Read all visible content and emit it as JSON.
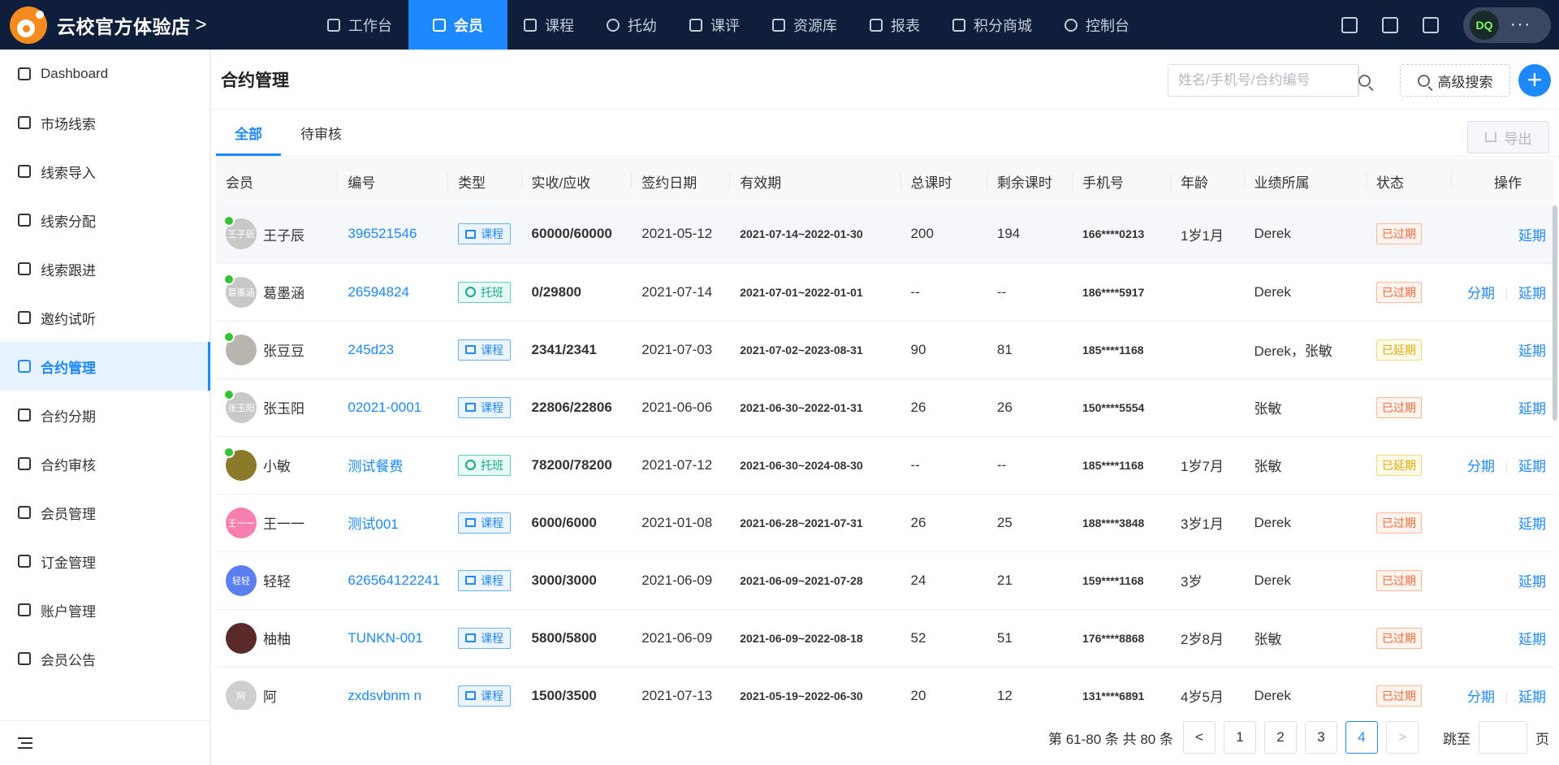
{
  "app": {
    "store_name": "云校官方体验店",
    "chevron": ">",
    "nav": [
      {
        "label": "工作台",
        "icon": "monitor-icon"
      },
      {
        "label": "会员",
        "icon": "user-icon",
        "active": true
      },
      {
        "label": "课程",
        "icon": "book-icon"
      },
      {
        "label": "托幼",
        "icon": "smile-icon"
      },
      {
        "label": "课评",
        "icon": "star-icon"
      },
      {
        "label": "资源库",
        "icon": "file-search-icon"
      },
      {
        "label": "报表",
        "icon": "chart-icon"
      },
      {
        "label": "积分商城",
        "icon": "shop-icon"
      },
      {
        "label": "控制台",
        "icon": "gear-icon"
      }
    ],
    "user_avatar_text": "DQ",
    "user_more": "···"
  },
  "sidebar": {
    "items": [
      {
        "label": "Dashboard",
        "icon": "dashboard-icon"
      },
      {
        "label": "市场线索",
        "icon": "clue-icon"
      },
      {
        "label": "线索导入",
        "icon": "import-icon"
      },
      {
        "label": "线索分配",
        "icon": "share-icon"
      },
      {
        "label": "线索跟进",
        "icon": "chat-icon"
      },
      {
        "label": "邀约试听",
        "icon": "invite-icon"
      },
      {
        "label": "合约管理",
        "icon": "contract-icon",
        "active": true
      },
      {
        "label": "合约分期",
        "icon": "installment-icon"
      },
      {
        "label": "合约审核",
        "icon": "audit-icon"
      },
      {
        "label": "会员管理",
        "icon": "members-icon"
      },
      {
        "label": "订金管理",
        "icon": "deposit-icon"
      },
      {
        "label": "账户管理",
        "icon": "account-icon"
      },
      {
        "label": "会员公告",
        "icon": "announce-icon"
      }
    ]
  },
  "header": {
    "title": "合约管理",
    "search_placeholder": "姓名/手机号/合约编号",
    "advanced_search": "高级搜索",
    "add": "+"
  },
  "tabs": [
    {
      "label": "全部",
      "active": true
    },
    {
      "label": "待审核"
    }
  ],
  "export_label": "导出",
  "table": {
    "columns": [
      "会员",
      "编号",
      "类型",
      "实收/应收",
      "签约日期",
      "有效期",
      "总课时",
      "剩余课时",
      "手机号",
      "年龄",
      "业绩所属",
      "状态",
      "操作"
    ],
    "rows": [
      {
        "name": "王子辰",
        "avatar_text": "王子辰",
        "avatar_color": "#c8c8c8",
        "wx": true,
        "code": "396521546",
        "type": "课程",
        "type_kind": "course",
        "amount": "60000/60000",
        "date": "2021-05-12",
        "period": "2021-07-14~2022-01-30",
        "total": "200",
        "remain": "194",
        "phone": "166****0213",
        "age": "1岁1月",
        "owner": "Derek",
        "status": "已过期",
        "status_kind": "expired",
        "ops": [
          "延期"
        ]
      },
      {
        "name": "葛墨涵",
        "avatar_text": "葛墨涵",
        "avatar_color": "#c8c8c8",
        "wx": true,
        "code": "26594824",
        "type": "托班",
        "type_kind": "care",
        "amount": "0/29800",
        "date": "2021-07-14",
        "period": "2021-07-01~2022-01-01",
        "total": "--",
        "remain": "--",
        "phone": "186****5917",
        "age": "",
        "owner": "Derek",
        "status": "已过期",
        "status_kind": "expired",
        "ops": [
          "分期",
          "延期"
        ]
      },
      {
        "name": "张豆豆",
        "avatar_text": "",
        "avatar_color": "#b9b4ae",
        "wx": true,
        "code": "245d23",
        "type": "课程",
        "type_kind": "course",
        "amount": "2341/2341",
        "date": "2021-07-03",
        "period": "2021-07-02~2023-08-31",
        "total": "90",
        "remain": "81",
        "phone": "185****1168",
        "age": "",
        "owner": "Derek，张敏",
        "status": "已延期",
        "status_kind": "extended",
        "ops": [
          "延期"
        ]
      },
      {
        "name": "张玉阳",
        "avatar_text": "张玉阳",
        "avatar_color": "#c8c8c8",
        "wx": true,
        "code": "02021-0001",
        "type": "课程",
        "type_kind": "course",
        "amount": "22806/22806",
        "date": "2021-06-06",
        "period": "2021-06-30~2022-01-31",
        "total": "26",
        "remain": "26",
        "phone": "150****5554",
        "age": "",
        "owner": "张敏",
        "status": "已过期",
        "status_kind": "expired",
        "ops": [
          "延期"
        ]
      },
      {
        "name": "小敏",
        "avatar_text": "",
        "avatar_color": "#8a7a2a",
        "wx": true,
        "code": "测试餐费",
        "type": "托班",
        "type_kind": "care",
        "amount": "78200/78200",
        "date": "2021-07-12",
        "period": "2021-06-30~2024-08-30",
        "total": "--",
        "remain": "--",
        "phone": "185****1168",
        "age": "1岁7月",
        "owner": "张敏",
        "status": "已延期",
        "status_kind": "extended",
        "ops": [
          "分期",
          "延期"
        ]
      },
      {
        "name": "王一一",
        "avatar_text": "王一一",
        "avatar_color": "#f77fb0",
        "wx": false,
        "code": "测试001",
        "type": "课程",
        "type_kind": "course",
        "amount": "6000/6000",
        "date": "2021-01-08",
        "period": "2021-06-28~2021-07-31",
        "total": "26",
        "remain": "25",
        "phone": "188****3848",
        "age": "3岁1月",
        "owner": "Derek",
        "status": "已过期",
        "status_kind": "expired",
        "ops": [
          "延期"
        ]
      },
      {
        "name": "轻轻",
        "avatar_text": "轻轻",
        "avatar_color": "#5b7ff0",
        "wx": false,
        "code": "626564122241",
        "type": "课程",
        "type_kind": "course",
        "amount": "3000/3000",
        "date": "2021-06-09",
        "period": "2021-06-09~2021-07-28",
        "total": "24",
        "remain": "21",
        "phone": "159****1168",
        "age": "3岁",
        "owner": "Derek",
        "status": "已过期",
        "status_kind": "expired",
        "ops": [
          "延期"
        ]
      },
      {
        "name": "柚柚",
        "avatar_text": "",
        "avatar_color": "#5a2a2a",
        "wx": false,
        "code": "TUNKN-001",
        "type": "课程",
        "type_kind": "course",
        "amount": "5800/5800",
        "date": "2021-06-09",
        "period": "2021-06-09~2022-08-18",
        "total": "52",
        "remain": "51",
        "phone": "176****8868",
        "age": "2岁8月",
        "owner": "张敏",
        "status": "已过期",
        "status_kind": "expired",
        "ops": [
          "延期"
        ]
      },
      {
        "name": "阿",
        "avatar_text": "阿",
        "avatar_color": "#cfcfcf",
        "wx": false,
        "code": "zxdsvbnm n",
        "type": "课程",
        "type_kind": "course",
        "amount": "1500/3500",
        "date": "2021-07-13",
        "period": "2021-05-19~2022-06-30",
        "total": "20",
        "remain": "12",
        "phone": "131****6891",
        "age": "4岁5月",
        "owner": "Derek",
        "status": "已过期",
        "status_kind": "expired",
        "ops": [
          "分期",
          "延期"
        ]
      }
    ]
  },
  "pagination": {
    "info": "第 61-80 条 共 80 条",
    "prev": "<",
    "next": ">",
    "pages": [
      "1",
      "2",
      "3",
      "4"
    ],
    "current": "4",
    "jump_label": "跳至",
    "page_suffix": "页"
  }
}
